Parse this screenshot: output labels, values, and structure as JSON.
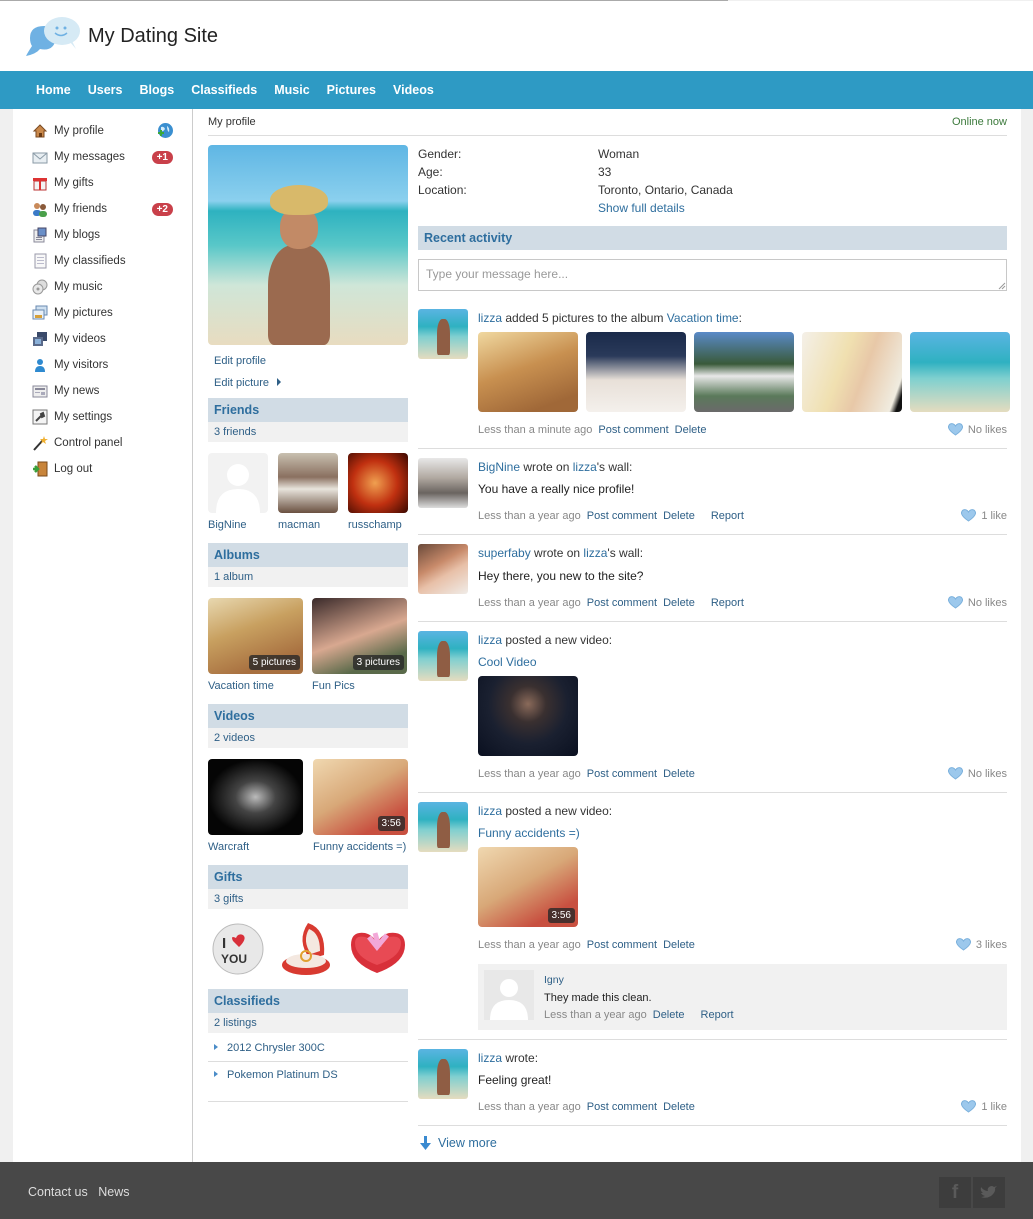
{
  "site": {
    "title": "My Dating Site"
  },
  "nav": [
    "Home",
    "Users",
    "Blogs",
    "Classifieds",
    "Music",
    "Pictures",
    "Videos"
  ],
  "sidebar": {
    "items": [
      {
        "label": "My profile",
        "icon": "home-icon",
        "extra": "globe"
      },
      {
        "label": "My messages",
        "icon": "envelope-icon",
        "badge": "+1"
      },
      {
        "label": "My gifts",
        "icon": "gift-icon"
      },
      {
        "label": "My friends",
        "icon": "friends-icon",
        "badge": "+2"
      },
      {
        "label": "My blogs",
        "icon": "blog-icon"
      },
      {
        "label": "My classifieds",
        "icon": "document-icon"
      },
      {
        "label": "My music",
        "icon": "music-cd-icon"
      },
      {
        "label": "My pictures",
        "icon": "pictures-icon"
      },
      {
        "label": "My videos",
        "icon": "film-icon"
      },
      {
        "label": "My visitors",
        "icon": "visitor-icon"
      },
      {
        "label": "My news",
        "icon": "news-icon"
      },
      {
        "label": "My settings",
        "icon": "settings-wrench-icon"
      },
      {
        "label": "Control panel",
        "icon": "magic-wand-icon"
      },
      {
        "label": "Log out",
        "icon": "door-exit-icon"
      }
    ]
  },
  "breadcrumb": "My profile",
  "status": "Online now",
  "profile": {
    "edit_profile": "Edit profile",
    "edit_picture": "Edit picture",
    "fields": [
      {
        "label": "Gender:",
        "value": "Woman"
      },
      {
        "label": "Age:",
        "value": "33"
      },
      {
        "label": "Location:",
        "value": "Toronto, Ontario, Canada"
      }
    ],
    "show_details": "Show full details"
  },
  "friends": {
    "title": "Friends",
    "count": "3 friends",
    "items": [
      "BigNine",
      "macman",
      "russchamp"
    ]
  },
  "albums": {
    "title": "Albums",
    "count": "1 album",
    "items": [
      {
        "name": "Vacation time",
        "badge": "5 pictures"
      },
      {
        "name": "Fun Pics",
        "badge": "3 pictures"
      }
    ]
  },
  "videos": {
    "title": "Videos",
    "count": "2 videos",
    "items": [
      {
        "name": "Warcraft",
        "duration": ""
      },
      {
        "name": "Funny accidents =)",
        "duration": "3:56"
      }
    ]
  },
  "gifts": {
    "title": "Gifts",
    "count": "3 gifts",
    "items": [
      "i-love-you-button",
      "ring-box",
      "heart-gift-box"
    ],
    "button_text": [
      "I",
      "YOU"
    ]
  },
  "classifieds": {
    "title": "Classifieds",
    "count": "2 listings",
    "items": [
      "2012 Chrysler 300C",
      "Pokemon Platinum DS"
    ]
  },
  "activity": {
    "title": "Recent activity",
    "placeholder": "Type your message here...",
    "feed": [
      {
        "user": "lizza",
        "action": " added 5 pictures to the album ",
        "target": "Vacation time",
        "suffix": ":",
        "time": "Less than a minute ago",
        "actions": [
          "Post comment",
          "Delete"
        ],
        "likes": "No likes"
      },
      {
        "user": "BigNine",
        "action": " wrote on ",
        "target": "lizza",
        "suffix": "'s wall:",
        "body": "You have a really nice profile!",
        "time": "Less than a year ago",
        "actions": [
          "Post comment",
          "Delete",
          "Report"
        ],
        "likes": "1 like"
      },
      {
        "user": "superfaby",
        "action": " wrote on ",
        "target": "lizza",
        "suffix": "'s wall:",
        "body": "Hey there, you new to the site?",
        "time": "Less than a year ago",
        "actions": [
          "Post comment",
          "Delete",
          "Report"
        ],
        "likes": "No likes"
      },
      {
        "user": "lizza",
        "action": " posted a new video:",
        "video": "Cool Video",
        "time": "Less than a year ago",
        "actions": [
          "Post comment",
          "Delete"
        ],
        "likes": "No likes"
      },
      {
        "user": "lizza",
        "action": " posted a new video:",
        "video": "Funny accidents =)",
        "duration": "3:56",
        "time": "Less than a year ago",
        "actions": [
          "Post comment",
          "Delete"
        ],
        "likes": "3 likes",
        "comment": {
          "user": "Igny",
          "text": "They made this clean.",
          "time": "Less than a year ago",
          "actions": [
            "Delete",
            "Report"
          ]
        }
      },
      {
        "user": "lizza",
        "action": " wrote:",
        "body": "Feeling great!",
        "time": "Less than a year ago",
        "actions": [
          "Post comment",
          "Delete"
        ],
        "likes": "1 like"
      }
    ],
    "view_more": "View more"
  },
  "footer": {
    "links": [
      "Contact us",
      "News"
    ],
    "social": [
      "facebook",
      "twitter"
    ],
    "social_glyphs": [
      "f",
      "t"
    ]
  },
  "colors": {
    "nav": "#2e9ac4",
    "section_header": "#d1dce5",
    "link": "#2e6e9e",
    "badge": "#c9404a",
    "online": "#3c7a3c",
    "footer": "#484848"
  }
}
